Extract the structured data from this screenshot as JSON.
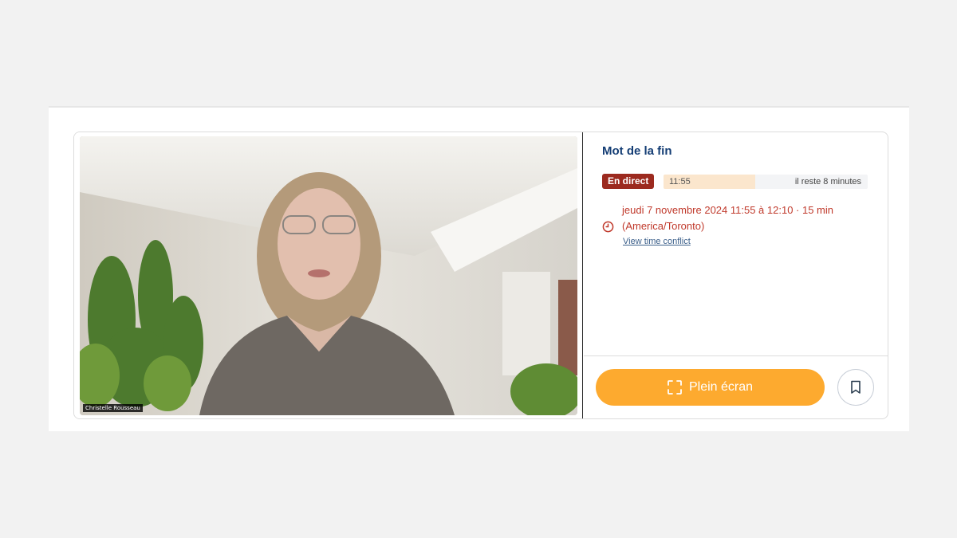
{
  "video": {
    "speaker_name": "Christelle Rousseau"
  },
  "session": {
    "title": "Mot de la fin",
    "live_badge": "En direct",
    "start_time": "11:55",
    "remaining": "il reste 8 minutes",
    "progress_fraction": 0.45,
    "schedule_line1": "jeudi 7 novembre 2024 11:55 à 12:10 · 15 min",
    "schedule_line2": "(America/Toronto)",
    "conflict_link": "View time conflict"
  },
  "actions": {
    "fullscreen_label": "Plein écran",
    "fullscreen_icon": "fullscreen-icon",
    "bookmark_icon": "bookmark-icon"
  },
  "colors": {
    "title": "#153e75",
    "live_badge": "#9c2a1f",
    "schedule_text": "#c0392b",
    "primary_button": "#fdaa2f",
    "progress_fill": "#fbe6cd"
  }
}
